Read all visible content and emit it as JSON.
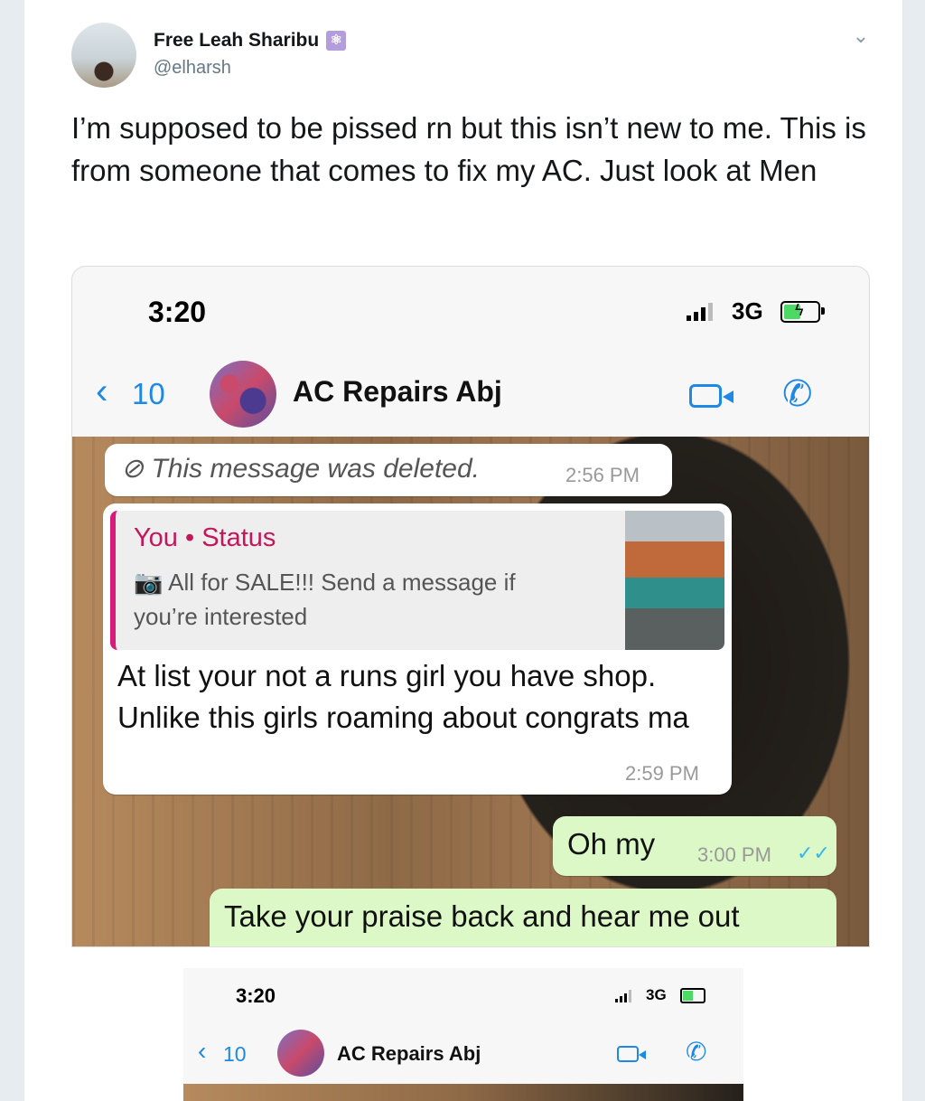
{
  "tweet": {
    "display_name": "Free Leah Sharibu",
    "badge_icon": "atom-emoji-icon",
    "handle": "@elharsh",
    "text": "I’m supposed to be pissed rn but this isn’t new to me. This is from someone that comes to fix my AC. Just look at Men"
  },
  "screenshot1": {
    "status_time": "3:20",
    "network": "3G",
    "back_count": "10",
    "chat_name": "AC Repairs Abj",
    "messages": [
      {
        "text": "This message was deleted.",
        "time": "2:56 PM"
      },
      {
        "quote_title": "You • Status",
        "quote_text": "All for SALE!!! Send a message if you’re interested",
        "text": "At list your not a runs girl you have shop. Unlike this girls roaming about congrats ma",
        "time": "2:59 PM"
      },
      {
        "text": "Oh my",
        "time": "3:00 PM"
      },
      {
        "text": "Take your praise back and hear me out"
      }
    ]
  },
  "screenshot2": {
    "status_time": "3:20",
    "network": "3G",
    "back_count": "10",
    "chat_name": "AC Repairs Abj"
  },
  "colors": {
    "ios_blue": "#1e88e5",
    "status_pink": "#c2185b",
    "outgoing_green": "#dcf8c6"
  }
}
